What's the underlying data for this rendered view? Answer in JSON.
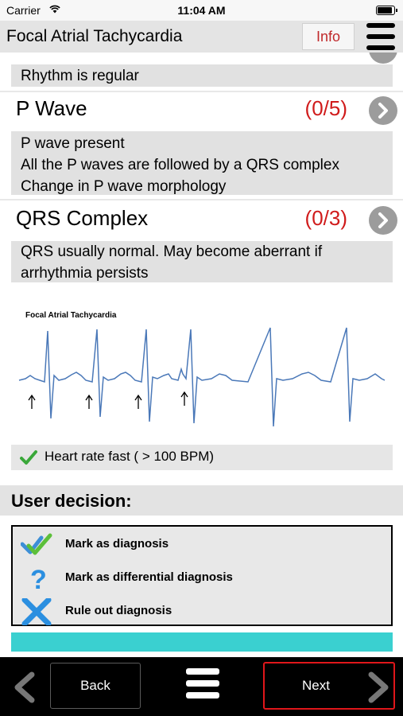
{
  "status_bar": {
    "carrier": "Carrier",
    "time": "11:04 AM"
  },
  "header": {
    "title": "Focal Atrial Tachycardia",
    "info_label": "Info"
  },
  "sections": {
    "rhythm": {
      "text": "Rhythm is regular"
    },
    "p_wave": {
      "title": "P Wave",
      "score": "(0/5)",
      "lines": [
        "P wave present",
        "All the P waves are  followed by a QRS complex",
        "Change in P wave morphology"
      ]
    },
    "qrs": {
      "title": "QRS Complex",
      "score": "(0/3)",
      "lines": [
        "QRS usually normal. May become aberrant if",
        "arrhythmia persists"
      ]
    }
  },
  "ecg": {
    "title": "Focal Atrial Tachycardia",
    "line_color": "#4a78b8"
  },
  "heart_rate": {
    "text": "Heart rate fast ( > 100 BPM)",
    "check_color": "#3aa83a"
  },
  "decision": {
    "title": "User decision:",
    "options": [
      {
        "label": "Mark as diagnosis",
        "icon": "double-check-icon"
      },
      {
        "label": "Mark as differential diagnosis",
        "icon": "question-icon"
      },
      {
        "label": "Rule out diagnosis",
        "icon": "cross-icon"
      }
    ]
  },
  "toolbar": {
    "back_label": "Back",
    "next_label": "Next"
  },
  "colors": {
    "accent_red": "#d01b1b",
    "teal": "#3ad0d0",
    "next_border": "#e0161a"
  }
}
